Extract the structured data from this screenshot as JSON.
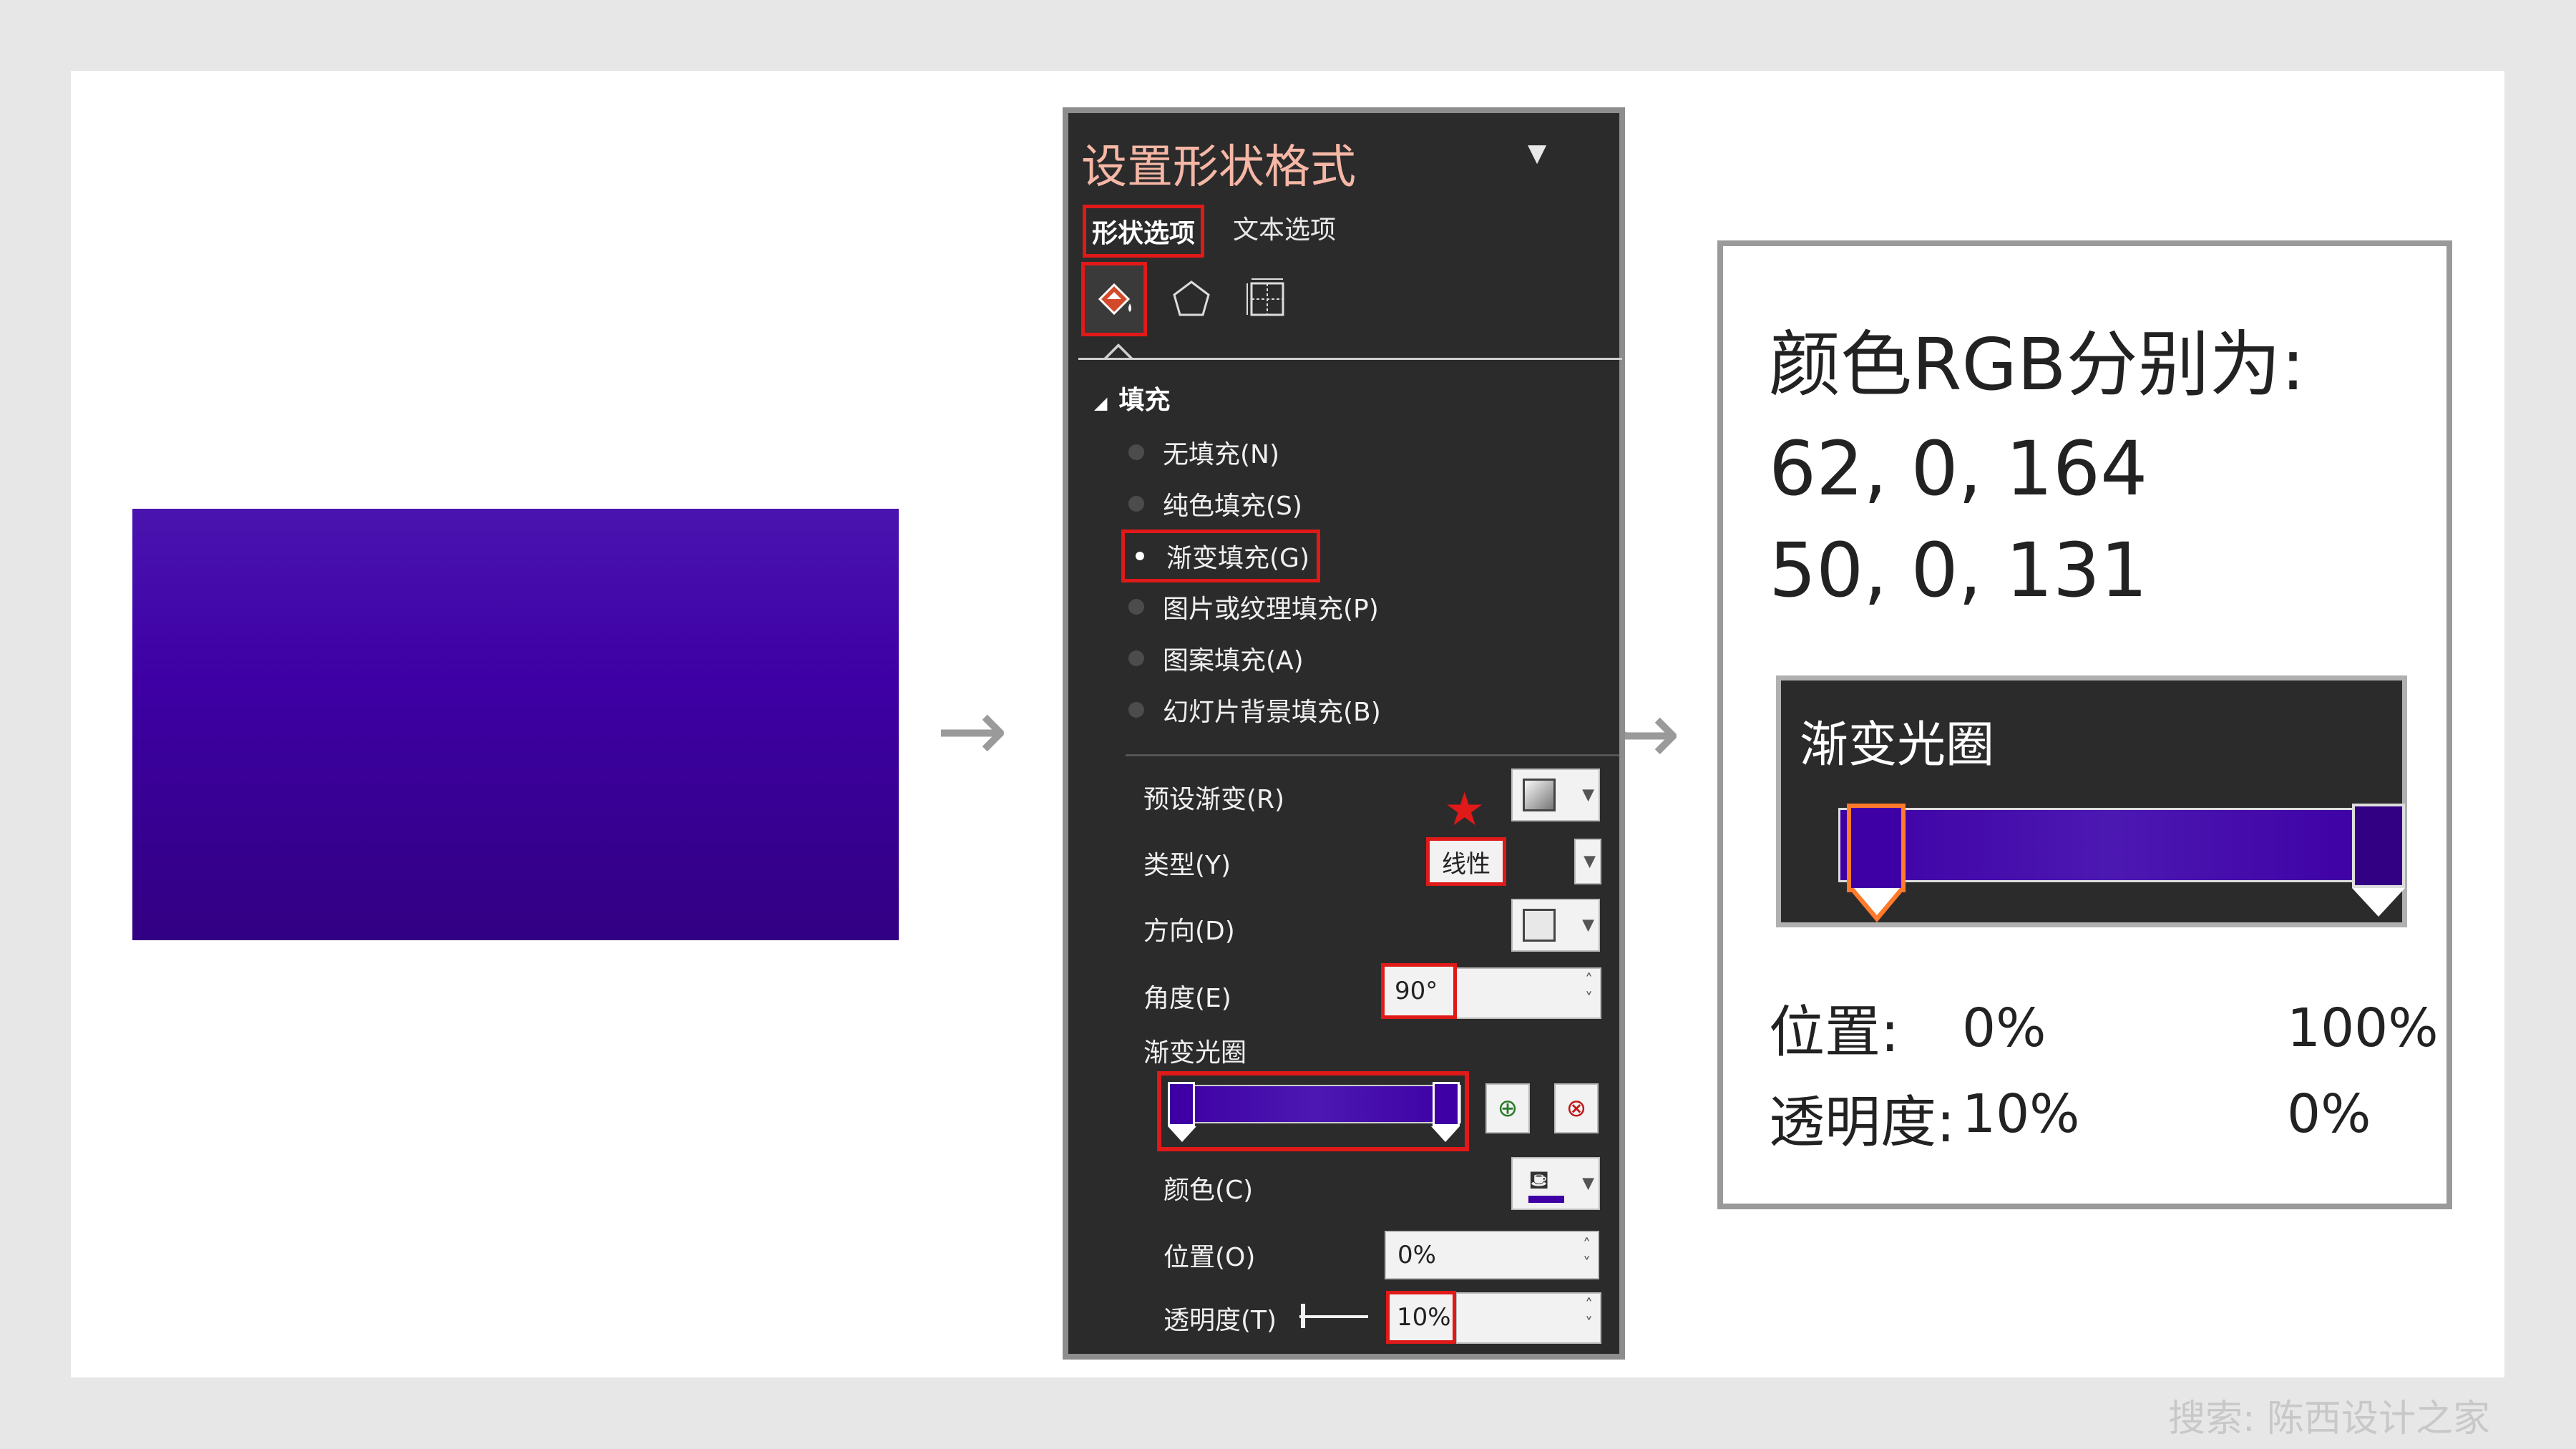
{
  "pane": {
    "title": "设置形状格式",
    "menu_glyph": "▼",
    "tabs": [
      {
        "label": "形状选项"
      },
      {
        "label": "文本选项"
      }
    ],
    "section_title": "填充",
    "fill_options": [
      {
        "label": "无填充(N)"
      },
      {
        "label": "纯色填充(S)"
      },
      {
        "label": "渐变填充(G)"
      },
      {
        "label": "图片或纹理填充(P)"
      },
      {
        "label": "图案填充(A)"
      },
      {
        "label": "幻灯片背景填充(B)"
      }
    ],
    "selected_fill": "渐变填充(G)",
    "preset_label": "预设渐变(R)",
    "type_label": "类型(Y)",
    "type_value": "线性",
    "direction_label": "方向(D)",
    "angle_label": "角度(E)",
    "angle_value": "90°",
    "stops_label": "渐变光圈",
    "color_label": "颜色(C)",
    "position_label": "位置(O)",
    "position_value": "0%",
    "transparency_label": "透明度(T)",
    "transparency_value": "10%"
  },
  "card": {
    "title": "颜色RGB分别为:",
    "rgb_lines": [
      "62, 0, 164",
      "50, 0, 131"
    ],
    "zoom_title": "渐变光圈",
    "position_label": "位置:",
    "position_values": [
      "0%",
      "100%"
    ],
    "transparency_label": "透明度:",
    "transparency_values": [
      "10%",
      "0%"
    ]
  },
  "watermark": "搜索: 陈西设计之家",
  "colors": {
    "gradient_start": "#3e00a4",
    "gradient_end": "#320083",
    "highlight": "#e01919",
    "pane_bg": "#2b2b2b"
  }
}
